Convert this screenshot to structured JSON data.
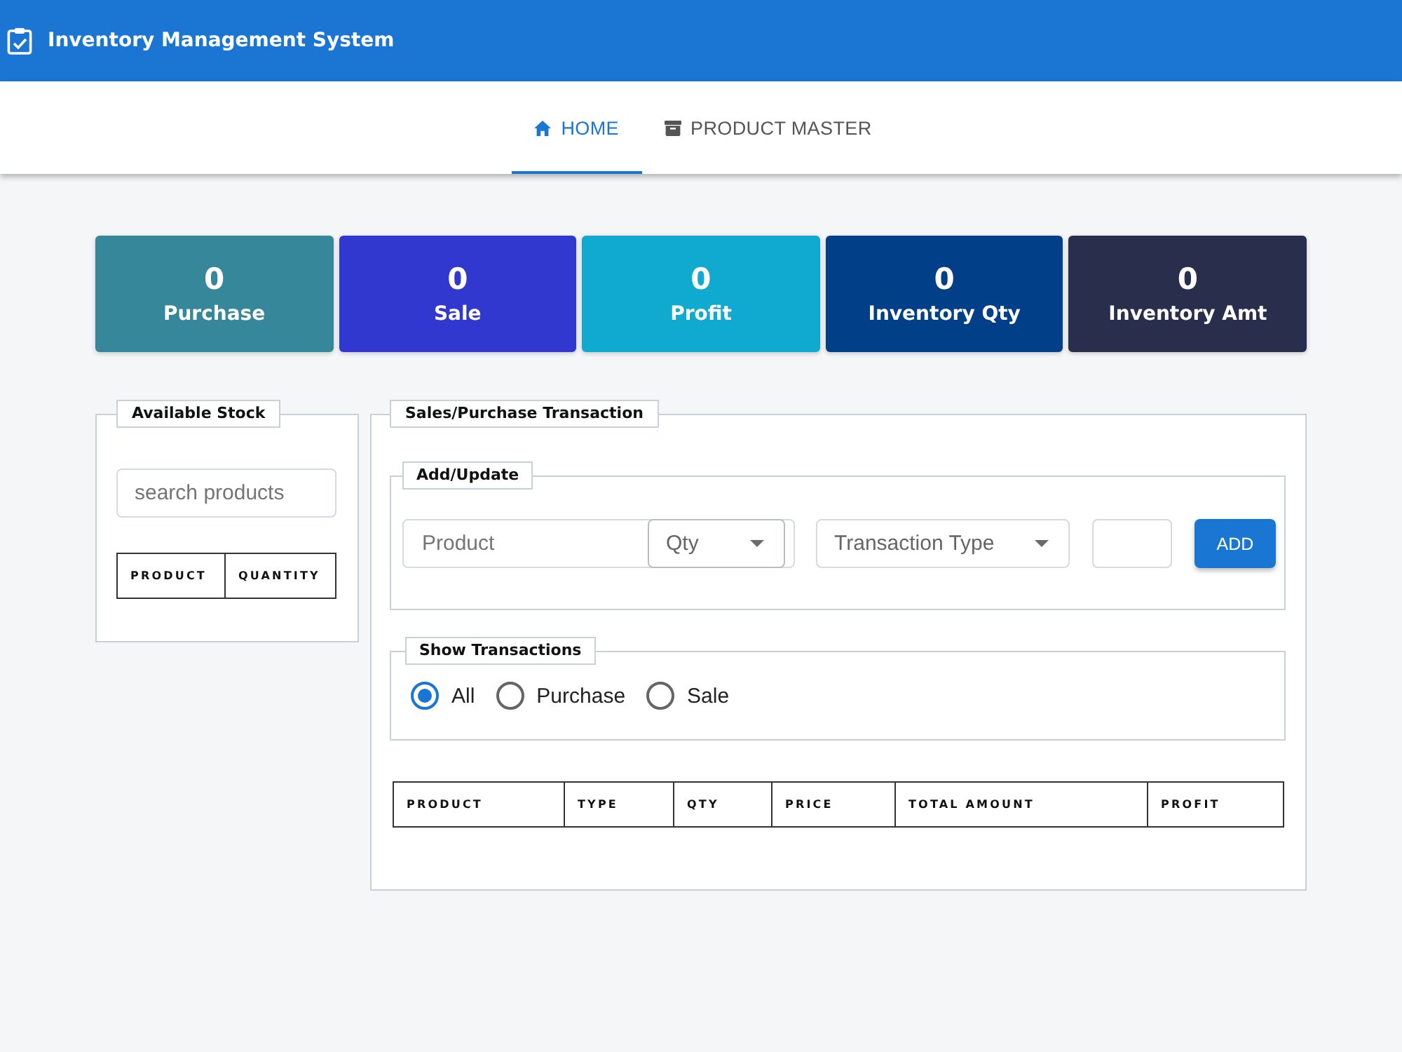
{
  "app_bar": {
    "title": "Inventory Management System"
  },
  "tabs": [
    {
      "label": "HOME",
      "selected": true
    },
    {
      "label": "PRODUCT MASTER",
      "selected": false
    }
  ],
  "stats": [
    {
      "value": "0",
      "label": "Purchase",
      "color": "#368799"
    },
    {
      "value": "0",
      "label": "Sale",
      "color": "#3038d0"
    },
    {
      "value": "0",
      "label": "Profit",
      "color": "#10a9cf"
    },
    {
      "value": "0",
      "label": "Inventory Qty",
      "color": "#014088"
    },
    {
      "value": "0",
      "label": "Inventory Amt",
      "color": "#282e4c"
    }
  ],
  "available_stock": {
    "title": "Available Stock",
    "search": {
      "placeholder": "search products"
    },
    "table": {
      "columns": [
        "PRODUCT",
        "QUANTITY"
      ]
    }
  },
  "transaction": {
    "title": "Sales/Purchase Transaction",
    "add_update": {
      "title": "Add/Update",
      "product": {
        "placeholder": "Product"
      },
      "qty": {
        "label": "Qty"
      },
      "transaction_type": {
        "label": "Transaction Type"
      },
      "add_button": "ADD"
    },
    "show_transactions": {
      "title": "Show Transactions",
      "options": [
        {
          "label": "All",
          "selected": true
        },
        {
          "label": "Purchase",
          "selected": false
        },
        {
          "label": "Sale",
          "selected": false
        }
      ]
    },
    "table": {
      "columns": [
        "PRODUCT",
        "TYPE",
        "QTY",
        "PRICE",
        "TOTAL AMOUNT",
        "PROFIT"
      ]
    }
  }
}
